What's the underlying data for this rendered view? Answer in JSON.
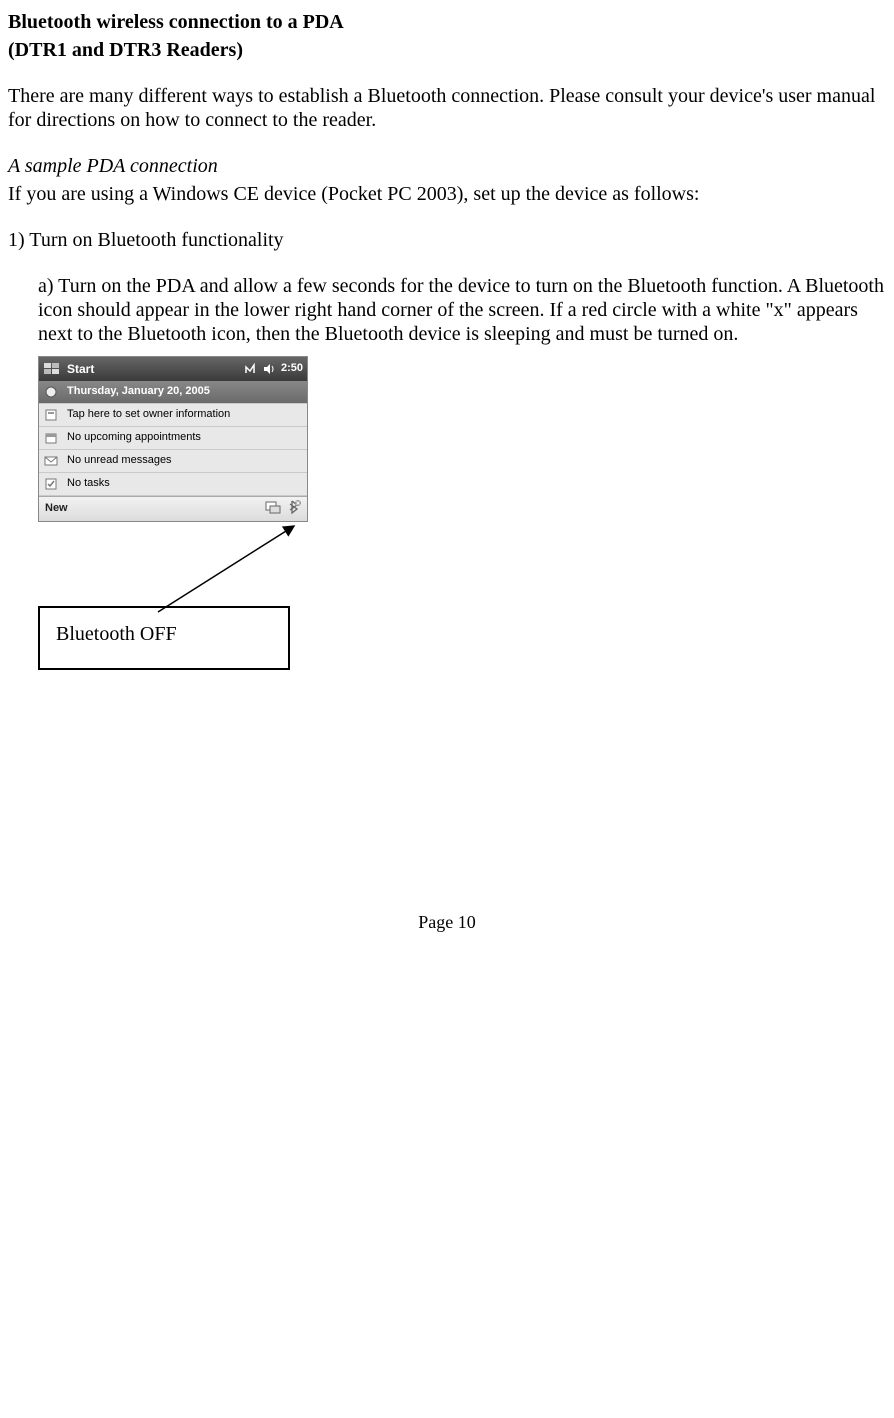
{
  "heading": {
    "line1": "Bluetooth wireless connection to a PDA",
    "line2": "(DTR1 and DTR3 Readers)"
  },
  "intro": "There are many different ways to establish a Bluetooth connection. Please consult your device's user manual for directions on how to connect  to the reader.",
  "subhead": "A sample PDA connection",
  "sub_body": "If you are using a Windows CE device (Pocket PC 2003), set up the device as follows:",
  "step1": "1) Turn on Bluetooth functionality",
  "step1a": "a) Turn on the PDA and allow a few seconds for the device to turn on the Bluetooth function. A Bluetooth icon should appear in the lower right hand corner of the screen. If a red circle with a white \"x\" appears next to the Bluetooth icon, then the Bluetooth device is sleeping and must be turned on.",
  "pda": {
    "start_label": "Start",
    "clock": "2:50",
    "date_row": "Thursday, January 20, 2005",
    "rows": [
      "Tap here to set owner information",
      "No upcoming appointments",
      "No unread messages",
      "No tasks"
    ],
    "new_label": "New"
  },
  "callout": "Bluetooth OFF",
  "footer": "Page 10"
}
